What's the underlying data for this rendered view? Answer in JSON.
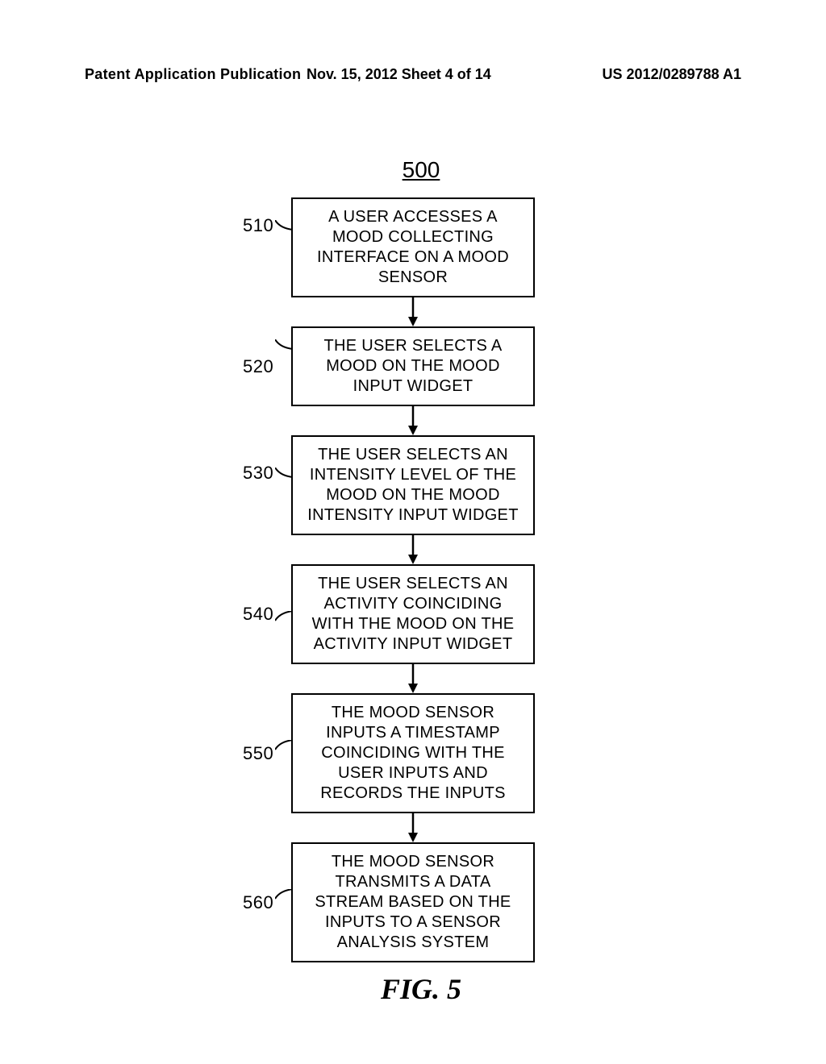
{
  "header": {
    "left": "Patent Application Publication",
    "center": "Nov. 15, 2012  Sheet 4 of 14",
    "right": "US 2012/0289788 A1"
  },
  "diagram": {
    "number": "500",
    "caption": "FIG. 5",
    "steps": [
      {
        "id": "510",
        "text": "A USER ACCESSES A MOOD COLLECTING INTERFACE ON A MOOD SENSOR"
      },
      {
        "id": "520",
        "text": "THE USER SELECTS A MOOD ON THE MOOD INPUT WIDGET"
      },
      {
        "id": "530",
        "text": "THE USER SELECTS AN INTENSITY LEVEL OF THE MOOD ON THE MOOD INTENSITY INPUT WIDGET"
      },
      {
        "id": "540",
        "text": "THE USER SELECTS AN ACTIVITY COINCIDING WITH THE MOOD ON THE ACTIVITY INPUT WIDGET"
      },
      {
        "id": "550",
        "text": "THE MOOD SENSOR INPUTS A TIMESTAMP COINCIDING WITH THE USER INPUTS AND RECORDS THE INPUTS"
      },
      {
        "id": "560",
        "text": "THE MOOD SENSOR TRANSMITS A DATA STREAM BASED ON THE INPUTS TO A SENSOR ANALYSIS SYSTEM"
      }
    ]
  }
}
